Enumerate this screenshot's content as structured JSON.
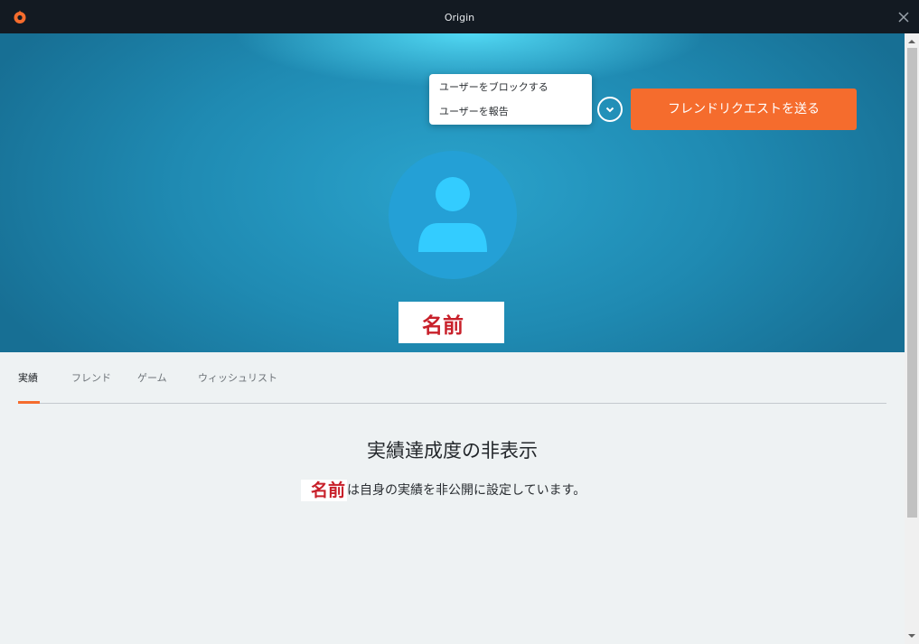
{
  "window": {
    "title": "Origin"
  },
  "colors": {
    "accent": "#f56c2d",
    "titlebar": "#131a22",
    "hero": "#1f8ab2",
    "name_red": "#c8202a"
  },
  "hero": {
    "send_request_label": "フレンドリクエストを送る",
    "more_button_icon": "chevron-down-icon",
    "dropdown": {
      "items": [
        {
          "label": "ユーザーをブロックする"
        },
        {
          "label": "ユーザーを報告"
        }
      ]
    },
    "avatar_icon": "user-silhouette-icon",
    "profile_name": "名前"
  },
  "tabs": [
    {
      "label": "実績",
      "active": true
    },
    {
      "label": "フレンド",
      "active": false
    },
    {
      "label": "ゲーム",
      "active": false
    },
    {
      "label": "ウィッシュリスト",
      "active": false
    }
  ],
  "achievements": {
    "heading": "実績達成度の非表示",
    "message_name": "名前",
    "message_text": "は自身の実績を非公開に設定しています。"
  }
}
